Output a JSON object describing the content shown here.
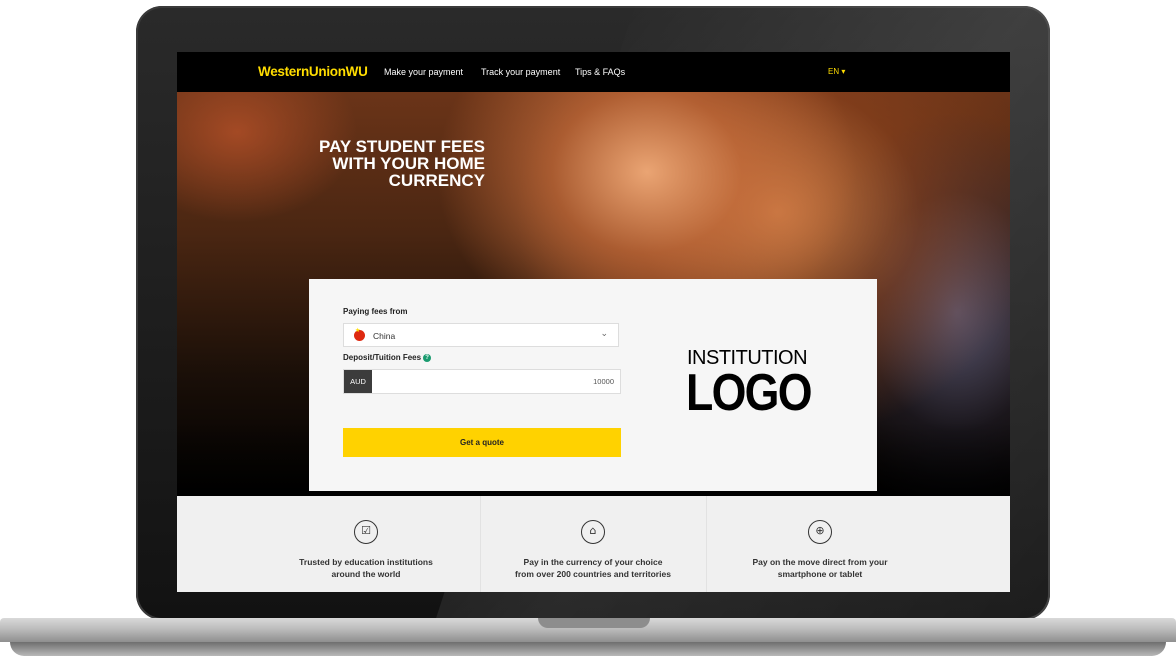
{
  "nav": {
    "logo_main": "WesternUnion",
    "logo_suffix": "WU",
    "items": [
      "Make your payment",
      "Track your payment",
      "Tips & FAQs"
    ],
    "language": "EN ▾"
  },
  "hero": {
    "headline": [
      "PAY STUDENT FEES",
      "WITH YOUR HOME",
      "CURRENCY"
    ]
  },
  "form": {
    "paying_from_label": "Paying fees from",
    "country": "China",
    "fees_label": "Deposit/Tuition Fees",
    "currency": "AUD",
    "amount": "10000",
    "quote_button": "Get a quote",
    "institution_line1": "INSTITUTION",
    "institution_line2": "LOGO"
  },
  "features": [
    {
      "icon": "checkbox-icon",
      "line1": "Trusted by education institutions",
      "line2": "around the world"
    },
    {
      "icon": "bank-seal-icon",
      "line1": "Pay in the currency of your choice",
      "line2": "from over 200 countries and territories"
    },
    {
      "icon": "globe-icon",
      "line1": "Pay on the move direct from your",
      "line2": "smartphone or tablet"
    }
  ],
  "colors": {
    "brand_yellow": "#ffdd00",
    "button_yellow": "#ffd200",
    "nav_bg": "#000000"
  }
}
